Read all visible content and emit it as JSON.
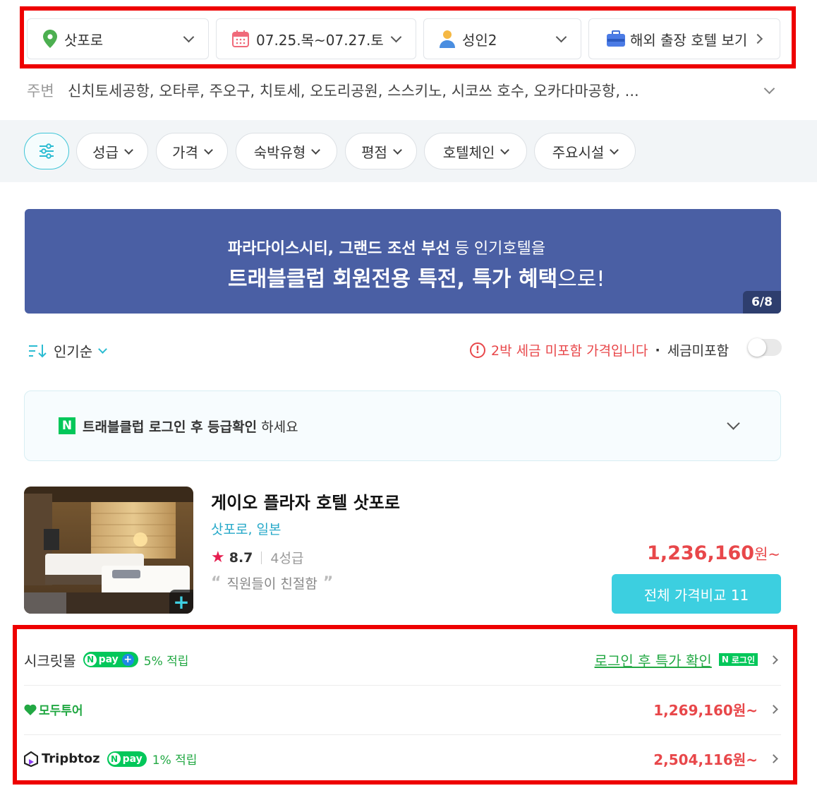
{
  "search": {
    "location": "삿포로",
    "dates": "07.25.목~07.27.토",
    "guests": "성인2",
    "business": "해외 출장 호텔 보기"
  },
  "nearby": {
    "label": "주변",
    "value": "신치토세공항, 오타루, 주오구, 치토세, 오도리공원, 스스키노, 시코쓰 호수, 오카다마공항, ..."
  },
  "filters": {
    "settings_icon": "sliders-icon",
    "items": [
      "성급",
      "가격",
      "숙박유형",
      "평점",
      "호텔체인",
      "주요시설"
    ]
  },
  "banner": {
    "line1_bold": "파라다이스시티, 그랜드 조선 부선",
    "line1_rest": " 등 인기호텔을",
    "line2_bold": "트래블클럽 회원전용 특전, 특가 혜택",
    "line2_rest": "으로!",
    "pager": "6/8",
    "bg": "#4a5fa4"
  },
  "sort": {
    "label": "인기순"
  },
  "tax": {
    "warning": "2박 세금 미포함 가격입니다",
    "dot": "·",
    "toggle_label": "세금미포함",
    "toggle_on": false
  },
  "login_card": {
    "n": "N",
    "bold": "트래블클럽 로그인 후 등급확인",
    "rest": " 하세요"
  },
  "hotel": {
    "name": "게이오 플라자 호텔 삿포로",
    "location": "삿포로, 일본",
    "score": "8.7",
    "grade": "4성급",
    "review": "직원들이 친절함",
    "price": "1,236,160",
    "price_unit": "원~",
    "compare_label": "전체 가격비교 11"
  },
  "vendors": [
    {
      "name": "시크릿몰",
      "npay": "pay",
      "accrual": "5% 적립",
      "login_text": "로그인 후 특가 확인",
      "login_badge": "로그인"
    },
    {
      "name": "모두투어",
      "price": "1,269,160원~"
    },
    {
      "name": "Tripbtoz",
      "npay": "pay",
      "accrual": "1% 적립",
      "price": "2,504,116원~"
    }
  ],
  "colors": {
    "accent": "#3ccfe0",
    "price": "#e8474a",
    "highlight": "#ee0000",
    "naver": "#03c75a"
  }
}
